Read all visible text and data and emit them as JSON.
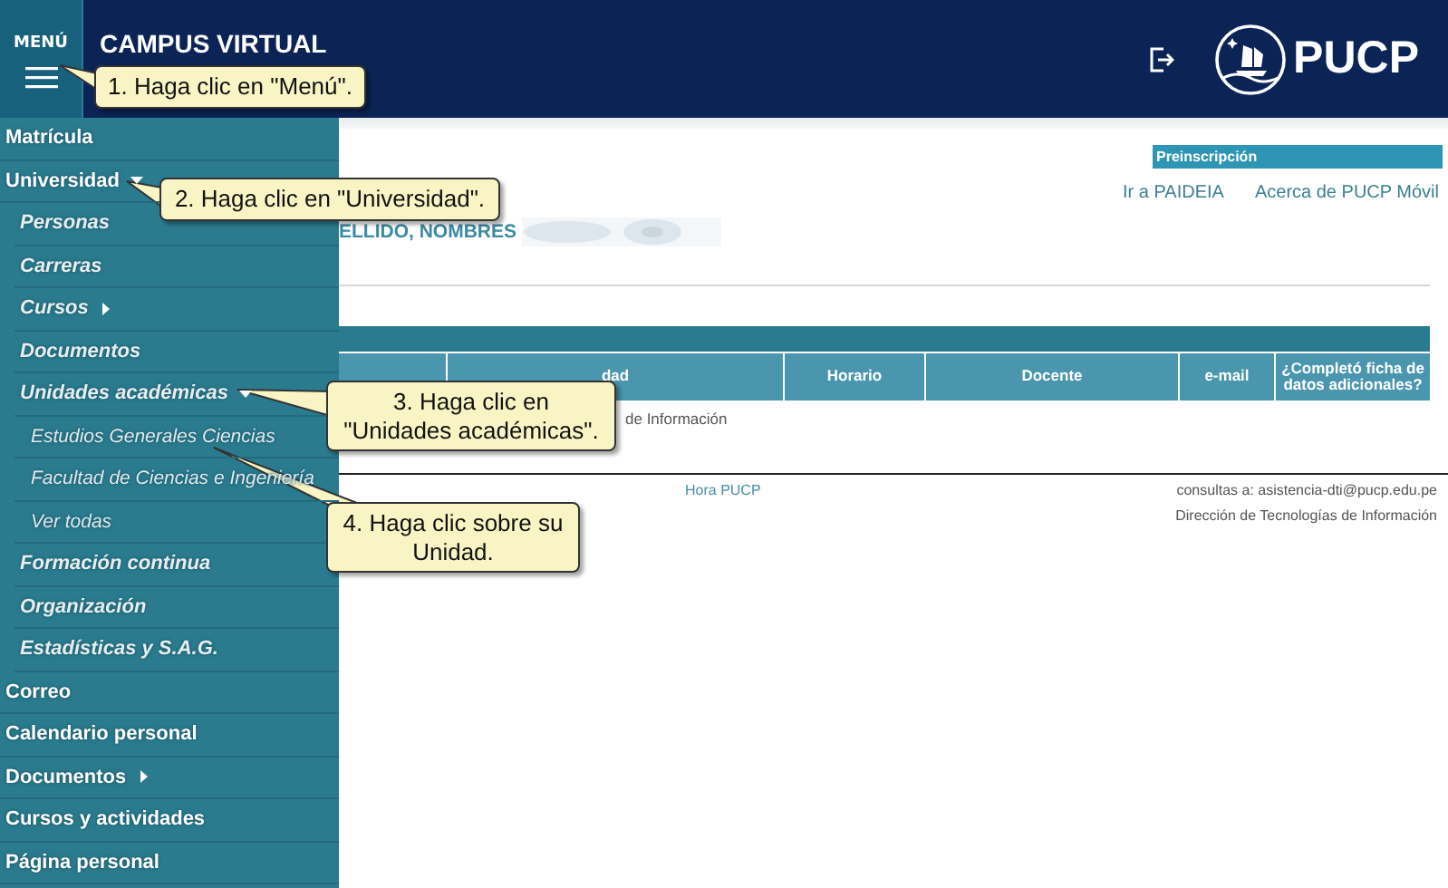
{
  "header": {
    "menu_label": "MENÚ",
    "title": "CAMPUS VIRTUAL",
    "logo_text": "PUCP"
  },
  "sidebar": {
    "items": [
      {
        "label": "Matrícula"
      },
      {
        "label": "Universidad",
        "expanded": true,
        "children": [
          {
            "label": "Personas"
          },
          {
            "label": "Carreras"
          },
          {
            "label": "Cursos",
            "expanded": false
          },
          {
            "label": "Documentos"
          },
          {
            "label": "Unidades académicas",
            "expanded": true,
            "children": [
              {
                "label": "Estudios Generales Ciencias"
              },
              {
                "label": "Facultad de Ciencias e Ingeniería"
              },
              {
                "label": "Ver todas"
              }
            ]
          },
          {
            "label": "Formación continua"
          },
          {
            "label": "Organización"
          },
          {
            "label": "Estadísticas y S.A.G."
          }
        ]
      },
      {
        "label": "Correo"
      },
      {
        "label": "Calendario personal"
      },
      {
        "label": "Documentos",
        "expanded": false
      },
      {
        "label": "Cursos y actividades"
      },
      {
        "label": "Página personal"
      }
    ]
  },
  "main": {
    "tab_label": "Preinscripción",
    "links": [
      "Ir a PAIDEIA",
      "Acerca de PUCP Móvil"
    ],
    "student_name": "ELLIDO, NOMBRES",
    "table": {
      "columns": [
        "dad",
        "Horario",
        "Docente",
        "e-mail",
        "¿Completó ficha de datos adicionales?"
      ],
      "row_text": "de Información"
    },
    "footer": {
      "clock_label": "Hora PUCP",
      "contact": "consultas a: asistencia-dti@pucp.edu.pe",
      "department": "Dirección de Tecnologías de Información"
    }
  },
  "callouts": [
    {
      "text": "1. Haga clic en \"Menú\"."
    },
    {
      "text": "2. Haga clic en \"Universidad\"."
    },
    {
      "text": "3. Haga clic en \"Unidades académicas\"."
    },
    {
      "text": "4. Haga clic sobre su Unidad."
    }
  ]
}
